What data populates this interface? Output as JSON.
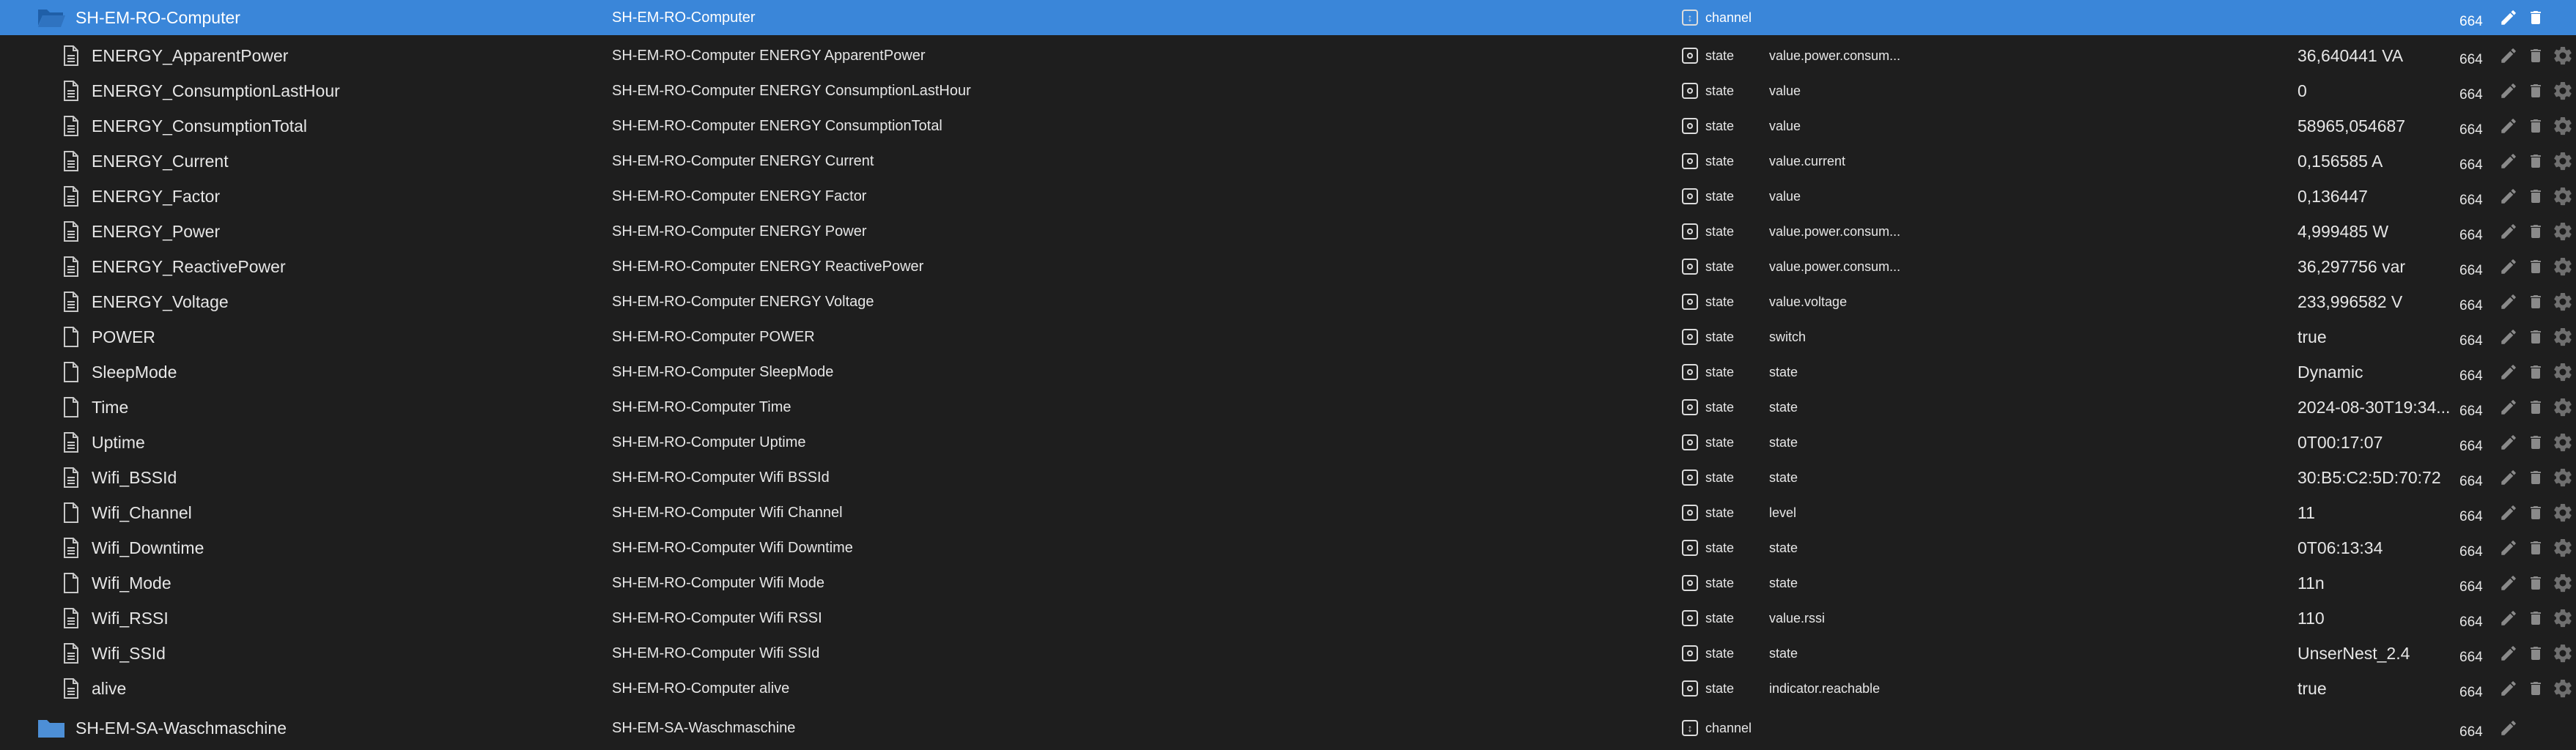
{
  "colors": {
    "background": "#1e1e1e",
    "selected": "#3a86d9",
    "text": "#e6e6e6",
    "icon": "#bdbdbd",
    "folder": "#4d8fd6"
  },
  "header_row": {
    "id": "SH-EM-RO-Computer",
    "name": "SH-EM-RO-Computer",
    "type": "channel",
    "acl": "664",
    "icon": "folder-open-icon"
  },
  "rows": [
    {
      "id": "ENERGY_ApparentPower",
      "name": "SH-EM-RO-Computer ENERGY ApparentPower",
      "type": "state",
      "role": "value.power.consum...",
      "value": "36,640441 VA",
      "acl": "664",
      "icon": "file-lines-icon"
    },
    {
      "id": "ENERGY_ConsumptionLastHour",
      "name": "SH-EM-RO-Computer ENERGY ConsumptionLastHour",
      "type": "state",
      "role": "value",
      "value": "0",
      "acl": "664",
      "icon": "file-lines-icon"
    },
    {
      "id": "ENERGY_ConsumptionTotal",
      "name": "SH-EM-RO-Computer ENERGY ConsumptionTotal",
      "type": "state",
      "role": "value",
      "value": "58965,054687",
      "acl": "664",
      "icon": "file-lines-icon"
    },
    {
      "id": "ENERGY_Current",
      "name": "SH-EM-RO-Computer ENERGY Current",
      "type": "state",
      "role": "value.current",
      "value": "0,156585 A",
      "acl": "664",
      "icon": "file-lines-icon"
    },
    {
      "id": "ENERGY_Factor",
      "name": "SH-EM-RO-Computer ENERGY Factor",
      "type": "state",
      "role": "value",
      "value": "0,136447",
      "acl": "664",
      "icon": "file-lines-icon"
    },
    {
      "id": "ENERGY_Power",
      "name": "SH-EM-RO-Computer ENERGY Power",
      "type": "state",
      "role": "value.power.consum...",
      "value": "4,999485 W",
      "acl": "664",
      "icon": "file-lines-icon"
    },
    {
      "id": "ENERGY_ReactivePower",
      "name": "SH-EM-RO-Computer ENERGY ReactivePower",
      "type": "state",
      "role": "value.power.consum...",
      "value": "36,297756 var",
      "acl": "664",
      "icon": "file-lines-icon"
    },
    {
      "id": "ENERGY_Voltage",
      "name": "SH-EM-RO-Computer ENERGY Voltage",
      "type": "state",
      "role": "value.voltage",
      "value": "233,996582 V",
      "acl": "664",
      "icon": "file-lines-icon"
    },
    {
      "id": "POWER",
      "name": "SH-EM-RO-Computer POWER",
      "type": "state",
      "role": "switch",
      "value": "true",
      "acl": "664",
      "icon": "file-icon"
    },
    {
      "id": "SleepMode",
      "name": "SH-EM-RO-Computer SleepMode",
      "type": "state",
      "role": "state",
      "value": "Dynamic",
      "acl": "664",
      "icon": "file-icon"
    },
    {
      "id": "Time",
      "name": "SH-EM-RO-Computer Time",
      "type": "state",
      "role": "state",
      "value": "2024-08-30T19:34...",
      "acl": "664",
      "icon": "file-icon"
    },
    {
      "id": "Uptime",
      "name": "SH-EM-RO-Computer Uptime",
      "type": "state",
      "role": "state",
      "value": "0T00:17:07",
      "acl": "664",
      "icon": "file-lines-icon"
    },
    {
      "id": "Wifi_BSSId",
      "name": "SH-EM-RO-Computer Wifi BSSId",
      "type": "state",
      "role": "state",
      "value": "30:B5:C2:5D:70:72",
      "acl": "664",
      "icon": "file-lines-icon"
    },
    {
      "id": "Wifi_Channel",
      "name": "SH-EM-RO-Computer Wifi Channel",
      "type": "state",
      "role": "level",
      "value": "11",
      "acl": "664",
      "icon": "file-icon"
    },
    {
      "id": "Wifi_Downtime",
      "name": "SH-EM-RO-Computer Wifi Downtime",
      "type": "state",
      "role": "state",
      "value": "0T06:13:34",
      "acl": "664",
      "icon": "file-lines-icon"
    },
    {
      "id": "Wifi_Mode",
      "name": "SH-EM-RO-Computer Wifi Mode",
      "type": "state",
      "role": "state",
      "value": "11n",
      "acl": "664",
      "icon": "file-icon"
    },
    {
      "id": "Wifi_RSSI",
      "name": "SH-EM-RO-Computer Wifi RSSI",
      "type": "state",
      "role": "value.rssi",
      "value": "110",
      "acl": "664",
      "icon": "file-lines-icon"
    },
    {
      "id": "Wifi_SSId",
      "name": "SH-EM-RO-Computer Wifi SSId",
      "type": "state",
      "role": "state",
      "value": "UnserNest_2.4",
      "acl": "664",
      "icon": "file-lines-icon"
    },
    {
      "id": "alive",
      "name": "SH-EM-RO-Computer alive",
      "type": "state",
      "role": "indicator.reachable",
      "value": "true",
      "acl": "664",
      "icon": "file-lines-icon"
    }
  ],
  "footer_row": {
    "id": "SH-EM-SA-Waschmaschine",
    "name": "SH-EM-SA-Waschmaschine",
    "type": "channel",
    "acl": "664",
    "icon": "folder-icon"
  }
}
